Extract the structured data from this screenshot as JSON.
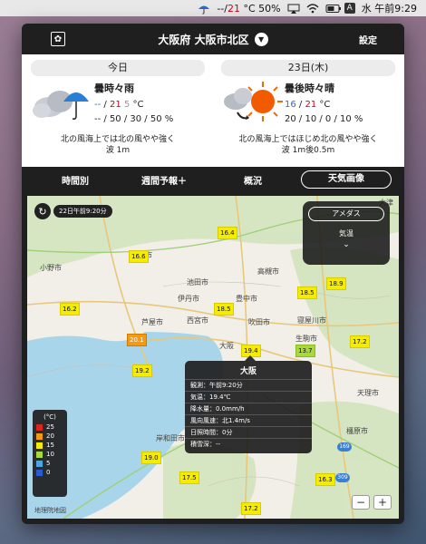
{
  "menubar": {
    "temps_prefix": "--",
    "temp_hi": "21",
    "temp_unit": "°C",
    "battery": "50%",
    "input_source": "A",
    "clock": "水 午前9:29"
  },
  "header": {
    "location": "大阪府 大阪市北区",
    "settings_label": "設定"
  },
  "today": {
    "tab": "今日",
    "condition": "曇時々雨",
    "temp_lo": "--",
    "temp_hi": "21",
    "temp_extra": "5",
    "temp_unit": "°C",
    "precip": "-- / 50 / 30 / 50 %",
    "wave_line1": "北の風海上では北の風やや強く",
    "wave_line2": "波 1m"
  },
  "tomorrow": {
    "tab": "23日(木)",
    "condition": "曇後時々晴",
    "temp_lo": "16",
    "temp_hi": "21",
    "temp_unit": "°C",
    "precip": "20 / 10 / 0 / 10 %",
    "wave_line1": "北の風海上ではほじめ北の風やや強く",
    "wave_line2": "波 1m後0.5m"
  },
  "tabs": [
    "時間別",
    "週間予報＋",
    "概況",
    "天気画像"
  ],
  "map": {
    "timestamp": "22日午前9:20分",
    "layers": {
      "active": "アメダス",
      "second": "気温",
      "chevron": "⌄"
    },
    "places": [
      "三田市",
      "小野市",
      "池田市",
      "高槻市",
      "伊丹市",
      "豊中市",
      "芦屋市",
      "西宮市",
      "吹田市",
      "寝屋川市",
      "大阪",
      "生駒市",
      "天理市",
      "岸和田市",
      "橿原市",
      "大津"
    ],
    "readings": [
      "16.4",
      "16.6",
      "16.2",
      "20.1",
      "19.2",
      "18.5",
      "18.5",
      "19.4",
      "13.7",
      "18.9",
      "17.2",
      "19.0",
      "17.5",
      "16.3",
      "17.2"
    ],
    "popup": {
      "title": "大阪",
      "rows": [
        "観測：午前9:20分",
        "気温：19.4℃",
        "降水量：0.0mm/h",
        "風向風速：北1.4m/s",
        "日照時間：0分",
        "積雪深：--"
      ]
    },
    "legend": {
      "unit": "(°C)",
      "items": [
        {
          "label": "25",
          "color": "#d7261e"
        },
        {
          "label": "20",
          "color": "#f29a14"
        },
        {
          "label": "15",
          "color": "#f6ec00"
        },
        {
          "label": "10",
          "color": "#a8d83a"
        },
        {
          "label": "5",
          "color": "#4aa8e0"
        },
        {
          "label": "0",
          "color": "#2a5bd1"
        }
      ]
    },
    "highways": [
      "169",
      "309"
    ],
    "zoom_out": "−",
    "zoom_in": "+",
    "credit": "地理院地図"
  }
}
